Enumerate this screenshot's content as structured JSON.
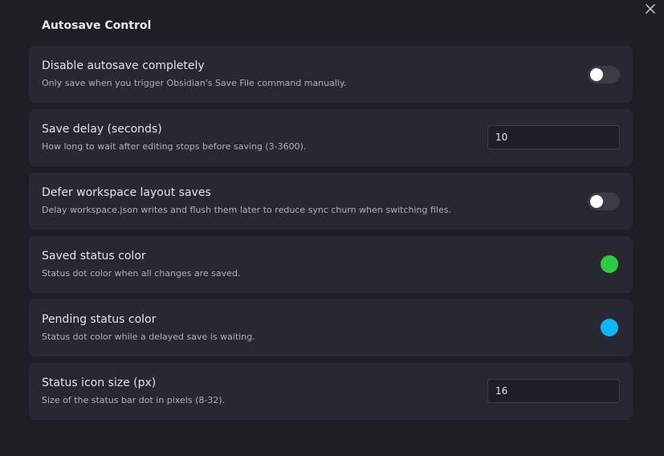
{
  "header": {
    "title": "Autosave Control",
    "close_icon": "close-icon"
  },
  "settings": [
    {
      "name": "Disable autosave completely",
      "desc": "Only save when you trigger Obsidian's Save File command manually.",
      "control": "toggle",
      "enabled": false
    },
    {
      "name": "Save delay (seconds)",
      "desc": "How long to wait after editing stops before saving (3-3600).",
      "control": "text",
      "value": "10"
    },
    {
      "name": "Defer workspace layout saves",
      "desc": "Delay workspace.json writes and flush them later to reduce sync churn when switching files.",
      "control": "toggle",
      "enabled": false
    },
    {
      "name": "Saved status color",
      "desc": "Status dot color when all changes are saved.",
      "control": "color",
      "color": "#2ecc40"
    },
    {
      "name": "Pending status color",
      "desc": "Status dot color while a delayed save is waiting.",
      "control": "color",
      "color": "#0fb5f5"
    },
    {
      "name": "Status icon size (px)",
      "desc": "Size of the status bar dot in pixels (8-32).",
      "control": "text",
      "value": "16"
    }
  ],
  "colors": {
    "background": "#1e1f25",
    "card": "#262932",
    "toggle_off": "#3a3d45"
  }
}
